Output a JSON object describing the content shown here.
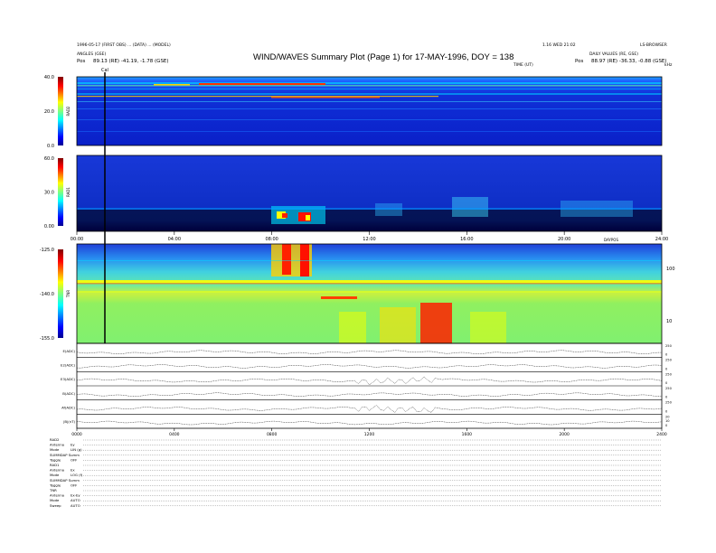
{
  "header": {
    "line1_left": "1996-05-17 (FIRST OBS) ... (DATA) ... (MODEL)",
    "line2_left": "ANGLES (GSE)",
    "pos_left_label": "Pos",
    "pos_left_value": "89.13 (RE) -41.19, -1.78 (GSE)",
    "line1_right": "1.16 WED 21:02",
    "corner_right": "LS-BROWSER",
    "line2_right": "DAILY VALUES (RE, GSE)",
    "pos_right_label": "Pos",
    "pos_right_value": "88.97 (RE) -36.33, -0.88 (GSE)",
    "title": "WIND/WAVES Summary Plot (Page 1) for 17-MAY-1996, DOY = 138",
    "cal_marker": "Cal",
    "top_axis_title": "TIME (UT)",
    "top_axis_unit": "kHz"
  },
  "chart_data": [
    {
      "type": "heatmap",
      "name": "RAD2",
      "ylabel": "RAD2",
      "ylim": [
        0,
        40
      ],
      "colorbar_ticks": [
        "40.0",
        "20.0",
        "0.0"
      ]
    },
    {
      "type": "heatmap",
      "name": "RAD1",
      "ylabel": "RAD1",
      "ylim": [
        0,
        60
      ],
      "colorbar_ticks": [
        "60.0",
        "30.0",
        "0.00"
      ],
      "x_ticks": [
        "00:00",
        "04:00",
        "08:00",
        "12:00",
        "16:00",
        "20:00",
        "24:00"
      ],
      "x_axis_label": "DAYPOS"
    },
    {
      "type": "heatmap",
      "name": "TNR",
      "ylabel": "TNR",
      "ylim": [
        -155,
        -125
      ],
      "colorbar_ticks": [
        "-125.0",
        "-140.0",
        "-155.0"
      ],
      "right_ticks": [
        "100",
        "10"
      ]
    },
    {
      "type": "line",
      "name": "parameter panels",
      "panels": [
        {
          "label": "E(ADC)",
          "right_ticks": [
            "250",
            "0"
          ]
        },
        {
          "label": "E2(ADC)",
          "right_ticks": [
            "250",
            "0"
          ]
        },
        {
          "label": "E3(ADC)",
          "right_ticks": [
            "250",
            "0"
          ]
        },
        {
          "label": "B(ADC)",
          "right_ticks": [
            "250",
            "0"
          ]
        },
        {
          "label": "Af(ADC)",
          "right_ticks": [
            "250",
            "0"
          ]
        },
        {
          "label": "|B|(nT)",
          "right_ticks": [
            "20",
            "10",
            "0"
          ]
        }
      ],
      "x_ticks": [
        "0000",
        "0400",
        "0800",
        "1200",
        "1600",
        "2000",
        "2400"
      ]
    }
  ],
  "status_rows": [
    {
      "label": "RAD2",
      "value": ""
    },
    {
      "label": "Antenna",
      "value": "Ey"
    },
    {
      "label": "Mode",
      "value": "LIN (g)"
    },
    {
      "label": "SUMMDAP Summ",
      "value": ""
    },
    {
      "label": "Toggle",
      "value": "OFF"
    },
    {
      "label": "RAD1",
      "value": ""
    },
    {
      "label": "Antenna",
      "value": "Ex"
    },
    {
      "label": "Mode",
      "value": "LOG (f)"
    },
    {
      "label": "SUMMDAP Summ",
      "value": ""
    },
    {
      "label": "Toggle",
      "value": "OFF"
    },
    {
      "label": "TNR",
      "value": ""
    },
    {
      "label": "Antenna",
      "value": "Ex-Ey"
    },
    {
      "label": "Mode",
      "value": "AUTO"
    },
    {
      "label": "Sweep",
      "value": "AUTO"
    }
  ]
}
